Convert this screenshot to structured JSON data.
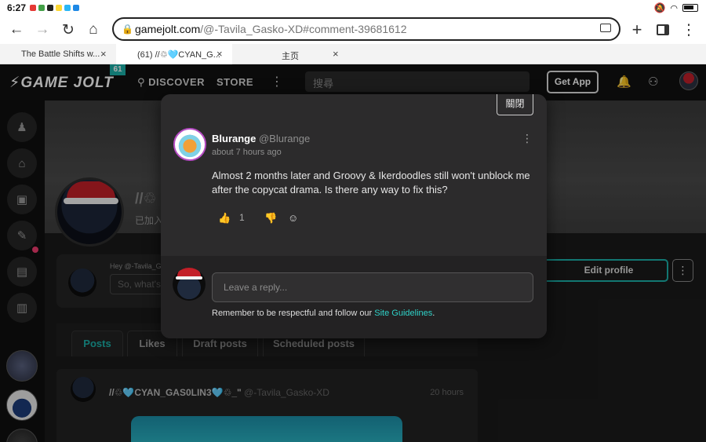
{
  "statusbar": {
    "time": "6:27",
    "notif_colors": [
      "#e53935",
      "#43a047",
      "#212121",
      "#fdd835",
      "#29b6f6",
      "#1e88e5"
    ]
  },
  "browser": {
    "back": "←",
    "forward": "→",
    "reload": "↻",
    "home": "⌂",
    "url_host": "gamejolt.com",
    "url_rest": "/@-Tavila_Gasko-XD#comment-39681612",
    "new_tab": "+",
    "menu": "⋮",
    "tabs": [
      {
        "title": "The Battle Shifts w...",
        "close": "×"
      },
      {
        "title": "(61) //♲🩵CYAN_G...",
        "close": "×"
      },
      {
        "title": "主页",
        "close": "×"
      }
    ]
  },
  "nav": {
    "logo": "⚡GAME JOLT",
    "badge": "61",
    "discover": "DISCOVER",
    "store": "STORE",
    "more": "⋮",
    "search_placeholder": "搜尋",
    "get_app": "Get App",
    "bell_icon": "🔔",
    "friends_icon": "⚇"
  },
  "profile": {
    "name": "//♲",
    "joined": "已加入",
    "hey": "Hey @-Tavila_G...",
    "composer_placeholder": "So, what's",
    "edit_profile": "Edit profile",
    "more": "⋮"
  },
  "tabs": [
    "Posts",
    "Likes",
    "Draft posts",
    "Scheduled posts"
  ],
  "post": {
    "author": "//♲🩵CYAN_GAS0LIN3🩵♲_\"",
    "handle": "@-Tavila_Gasko-XD",
    "time": "20 hours"
  },
  "modal": {
    "close": "關閉",
    "author": "Blurange",
    "handle": "@Blurange",
    "time": "about 7 hours ago",
    "body": "Almost 2 months later and Groovy & Ikerdoodles still won't unblock me after the copycat drama. Is there any way to fix this?",
    "like_count": "1",
    "reply_placeholder": "Leave a reply...",
    "note": "Remember to be respectful and follow our ",
    "note_link": "Site Guidelines",
    "note_end": "."
  }
}
